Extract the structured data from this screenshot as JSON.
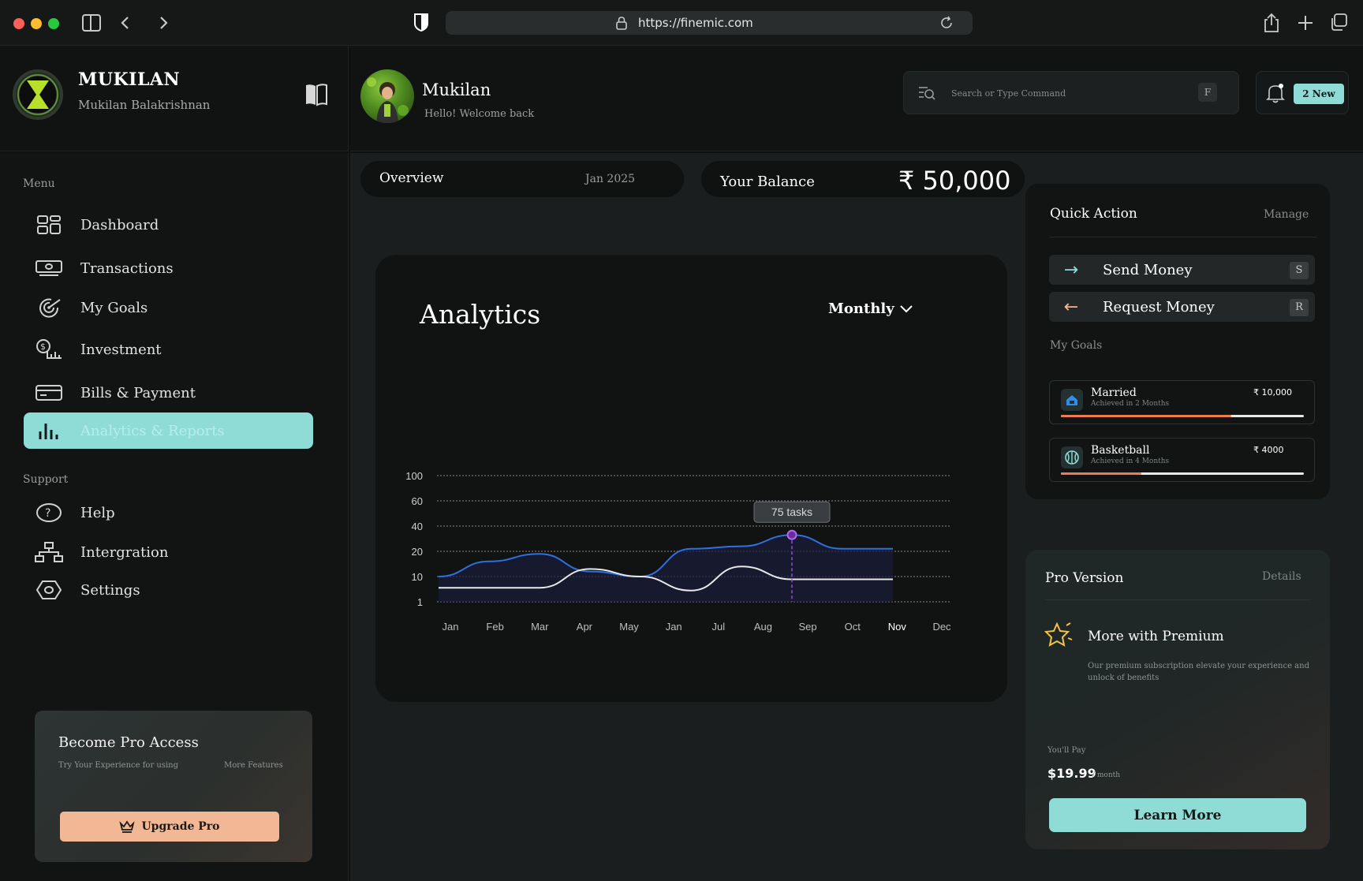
{
  "browser": {
    "url": "https://finemic.com"
  },
  "profile": {
    "name": "MUKILAN",
    "fullname": "Mukilan Balakrishnan"
  },
  "header": {
    "user_name": "Mukilan",
    "greeting": "Hello! Welcome back",
    "search_placeholder": "Search or Type Command",
    "search_shortcut": "F",
    "notifications_badge": "2 New"
  },
  "sidebar": {
    "menu_heading": "Menu",
    "menu_items": [
      {
        "label": "Dashboard",
        "icon": "dashboard-icon"
      },
      {
        "label": "Transactions",
        "icon": "cash-icon"
      },
      {
        "label": "My Goals",
        "icon": "target-icon"
      },
      {
        "label": "Investment",
        "icon": "investment-icon"
      },
      {
        "label": "Bills & Payment",
        "icon": "card-icon"
      },
      {
        "label": "Analytics & Reports",
        "icon": "bar-chart-icon",
        "active": true
      }
    ],
    "support_heading": "Support",
    "support_items": [
      {
        "label": "Help",
        "icon": "help-icon"
      },
      {
        "label": "Intergration",
        "icon": "network-icon"
      },
      {
        "label": "Settings",
        "icon": "settings-icon"
      }
    ],
    "pro_card": {
      "title": "Become Pro Access",
      "sub_left": "Try Your Experience for using",
      "sub_right": "More Features",
      "button": "Upgrade Pro"
    }
  },
  "overview": {
    "label": "Overview",
    "date": "Jan 2025"
  },
  "balance": {
    "label": "Your Balance",
    "amount": "₹ 50,000"
  },
  "analytics": {
    "title": "Analytics",
    "period": "Monthly",
    "tooltip": "75 tasks"
  },
  "chart_data": {
    "type": "line",
    "categories": [
      "Jan",
      "Feb",
      "Mar",
      "Apr",
      "May",
      "Jan",
      "Jul",
      "Aug",
      "Sep",
      "Oct",
      "Nov",
      "Dec"
    ],
    "y_ticks": [
      "100",
      "60",
      "40",
      "20",
      "10",
      "1"
    ],
    "highlighted_category": "Nov",
    "series": [
      {
        "color": "#2f6fe0",
        "values": [
          10,
          16,
          19,
          12,
          10,
          22,
          24,
          33,
          22,
          22
        ]
      },
      {
        "color": "#e8e8e8",
        "values": [
          6,
          6,
          6,
          13,
          10,
          5,
          14,
          9,
          9,
          9
        ]
      }
    ],
    "grid": "dotted horizontal",
    "legend": "none"
  },
  "quick_action": {
    "title": "Quick Action",
    "manage": "Manage",
    "send": {
      "label": "Send Money",
      "key": "S"
    },
    "request": {
      "label": "Request Money",
      "key": "R"
    },
    "goals_heading": "My Goals",
    "goals": [
      {
        "name": "Married",
        "sub": "Achieved in 2 Months",
        "amount": "₹ 10,000",
        "progress": 0.7,
        "icon": "home-icon"
      },
      {
        "name": "Basketball",
        "sub": "Achieved in 4 Months",
        "amount": "₹ 4000",
        "progress": 0.33,
        "icon": "basketball-icon"
      }
    ]
  },
  "pro_version": {
    "title": "Pro Version",
    "details": "Details",
    "headline": "More with Premium",
    "description": "Our premium subscription elevate your experience and unlock of benefits",
    "pay_label": "You'll Pay",
    "price": "$19.99",
    "per": "/ month",
    "button": "Learn More"
  },
  "colors": {
    "accent": "#8fdcd6",
    "orange": "#f2b895",
    "progress": "#ec7e4e"
  }
}
